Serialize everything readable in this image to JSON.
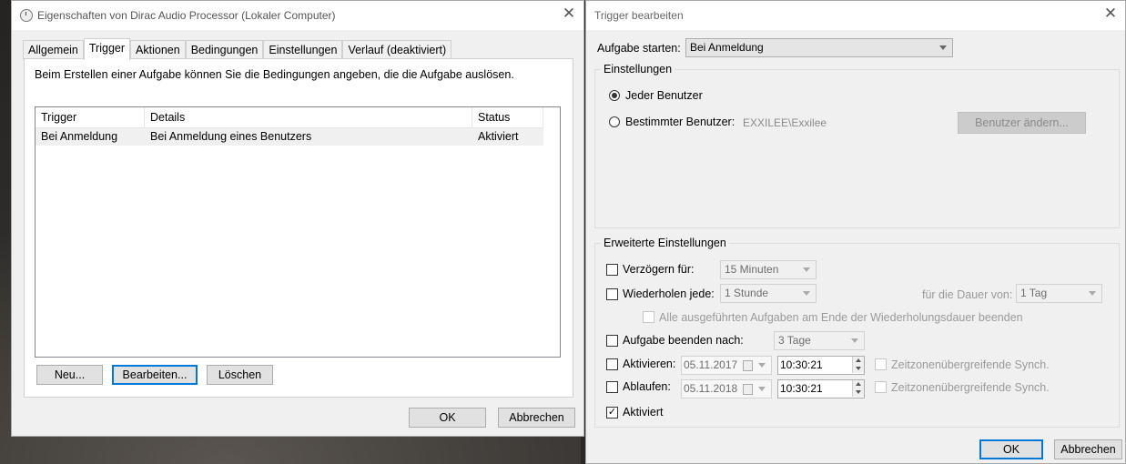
{
  "left_window": {
    "title": "Eigenschaften von Dirac Audio Processor (Lokaler Computer)",
    "tabs": [
      "Allgemein",
      "Trigger",
      "Aktionen",
      "Bedingungen",
      "Einstellungen",
      "Verlauf (deaktiviert)"
    ],
    "active_tab": "Trigger",
    "description": "Beim Erstellen einer Aufgabe können Sie die Bedingungen angeben, die die Aufgabe auslösen.",
    "table": {
      "columns": [
        "Trigger",
        "Details",
        "Status"
      ],
      "rows": [
        {
          "trigger": "Bei Anmeldung",
          "details": "Bei Anmeldung eines Benutzers",
          "status": "Aktiviert"
        }
      ]
    },
    "buttons": {
      "new": "Neu...",
      "edit": "Bearbeiten...",
      "delete": "Löschen"
    },
    "ok": "OK",
    "cancel": "Abbrechen"
  },
  "right_window": {
    "title": "Trigger bearbeiten",
    "start_label": "Aufgabe starten:",
    "start_value": "Bei Anmeldung",
    "settings_group": "Einstellungen",
    "radio_any_user": "Jeder Benutzer",
    "radio_specific_user": "Bestimmter Benutzer:",
    "specific_user_value": "EXXILEE\\Exxilee",
    "change_user_button": "Benutzer ändern...",
    "selected_radio": "any_user",
    "advanced_group": "Erweiterte Einstellungen",
    "delay_label": "Verzögern für:",
    "delay_value": "15 Minuten",
    "delay_checked": false,
    "repeat_label": "Wiederholen jede:",
    "repeat_value": "1 Stunde",
    "repeat_checked": false,
    "duration_label": "für die Dauer von:",
    "duration_value": "1 Tag",
    "stop_all_label": "Alle ausgeführten Aufgaben am Ende der Wiederholungsdauer beenden",
    "stop_after_label": "Aufgabe beenden nach:",
    "stop_after_value": "3 Tage",
    "stop_after_checked": false,
    "activate_label": "Aktivieren:",
    "activate_date": "05.11.2017",
    "activate_time": "10:30:21",
    "activate_checked": false,
    "sync_label": "Zeitzonenübergreifende Synch.",
    "expire_label": "Ablaufen:",
    "expire_date": "05.11.2018",
    "expire_time": "10:30:21",
    "expire_checked": false,
    "enabled_label": "Aktiviert",
    "enabled_checked": true,
    "ok": "OK",
    "cancel": "Abbrechen"
  },
  "icons": {
    "close": "close-icon",
    "clock": "clock-icon"
  }
}
